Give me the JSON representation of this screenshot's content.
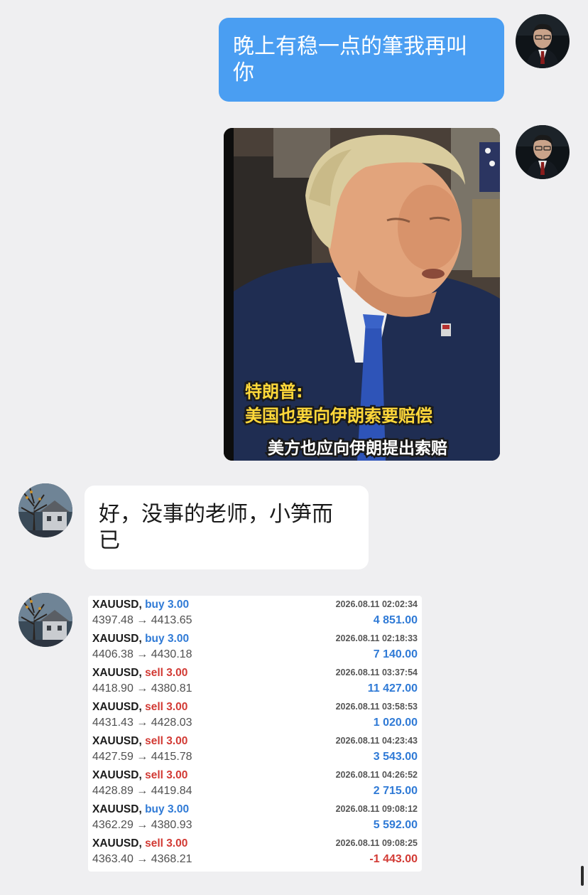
{
  "messages": {
    "outgoing_text": "晚上有稳一点的筆我再叫你",
    "video": {
      "caption_speaker": "特朗普:",
      "caption_quote": "美国也要向伊朗索要赔偿",
      "caption_sub": "美方也应向伊朗提出索赔"
    },
    "incoming_text": "好，没事的老师，小笋而已"
  },
  "trades": [
    {
      "symbol": "XAUUSD,",
      "direction": "buy 3.00",
      "side": "buy",
      "prices": "4397.48 → 4413.65",
      "time": "2026.08.11 02:02:34",
      "profit": "4 851.00",
      "profit_sign": "pos"
    },
    {
      "symbol": "XAUUSD,",
      "direction": "buy 3.00",
      "side": "buy",
      "prices": "4406.38 → 4430.18",
      "time": "2026.08.11 02:18:33",
      "profit": "7 140.00",
      "profit_sign": "pos"
    },
    {
      "symbol": "XAUUSD,",
      "direction": "sell 3.00",
      "side": "sell",
      "prices": "4418.90 → 4380.81",
      "time": "2026.08.11 03:37:54",
      "profit": "11 427.00",
      "profit_sign": "pos"
    },
    {
      "symbol": "XAUUSD,",
      "direction": "sell 3.00",
      "side": "sell",
      "prices": "4431.43 → 4428.03",
      "time": "2026.08.11 03:58:53",
      "profit": "1 020.00",
      "profit_sign": "pos"
    },
    {
      "symbol": "XAUUSD,",
      "direction": "sell 3.00",
      "side": "sell",
      "prices": "4427.59 → 4415.78",
      "time": "2026.08.11 04:23:43",
      "profit": "3 543.00",
      "profit_sign": "pos"
    },
    {
      "symbol": "XAUUSD,",
      "direction": "sell 3.00",
      "side": "sell",
      "prices": "4428.89 → 4419.84",
      "time": "2026.08.11 04:26:52",
      "profit": "2 715.00",
      "profit_sign": "pos"
    },
    {
      "symbol": "XAUUSD,",
      "direction": "buy 3.00",
      "side": "buy",
      "prices": "4362.29 → 4380.93",
      "time": "2026.08.11 09:08:12",
      "profit": "5 592.00",
      "profit_sign": "pos"
    },
    {
      "symbol": "XAUUSD,",
      "direction": "sell 3.00",
      "side": "sell",
      "prices": "4363.40 → 4368.21",
      "time": "2026.08.11 09:08:25",
      "profit": "-1 443.00",
      "profit_sign": "neg"
    }
  ],
  "colors": {
    "background": "#efeff1",
    "outgoing_bubble": "#4a9ef2",
    "incoming_bubble": "#ffffff",
    "buy": "#2f7ad6",
    "sell": "#d23a34",
    "caption_yellow": "#ffd83a"
  },
  "icons": {
    "avatar_me": "avatar-portrait",
    "avatar_them": "avatar-tree-house"
  }
}
